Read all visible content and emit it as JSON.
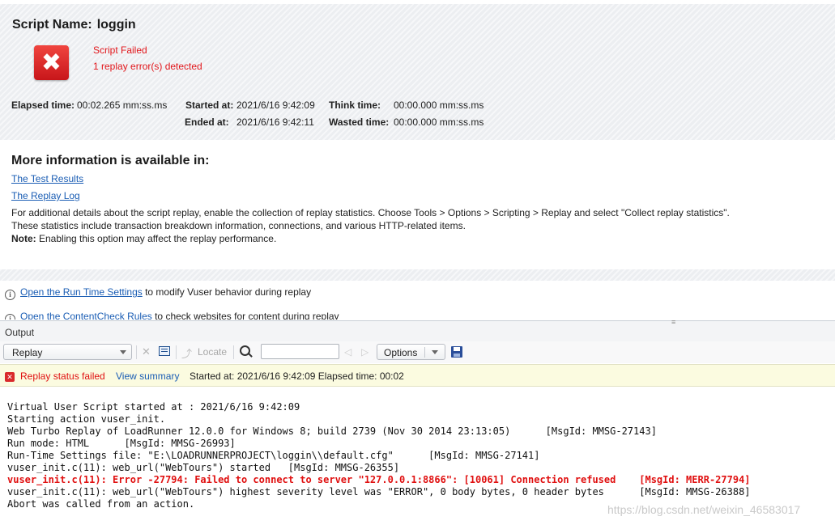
{
  "summary": {
    "script_label": "Script Name:",
    "script_name": "loggin",
    "status_title": "Script Failed",
    "status_detail": "1 replay error(s) detected",
    "elapsed_label": "Elapsed time:",
    "elapsed_value": "00:02.265 mm:ss.ms",
    "started_label": "Started at:",
    "started_value": "2021/6/16 9:42:09",
    "ended_label": "Ended at:",
    "ended_value": "2021/6/16 9:42:11",
    "think_label": "Think time:",
    "think_value": "00:00.000 mm:ss.ms",
    "wasted_label": "Wasted time:",
    "wasted_value": "00:00.000 mm:ss.ms"
  },
  "more": {
    "title": "More information is available in:",
    "link_results": "The Test Results",
    "link_log": "The Replay Log",
    "para1": "For additional details about the script replay, enable the collection of replay statistics. Choose Tools > Options > Scripting > Replay and select \"Collect replay statistics\".",
    "para2": "These statistics include transaction breakdown information, connections, and various HTTP-related items.",
    "note_label": "Note:",
    "note_text": " Enabling this option may affect the replay performance."
  },
  "tips": [
    {
      "link": "Open the Run Time Settings",
      "text": " to modify Vuser behavior during replay"
    },
    {
      "link": "Open the ContentCheck Rules",
      "text": " to check websites for content during replay"
    }
  ],
  "output": {
    "title": "Output",
    "mode_value": "Replay",
    "locate_label": "Locate",
    "search_value": "",
    "options_label": "Options"
  },
  "status": {
    "text": "Replay status failed",
    "view_summary": "View summary",
    "started": "Started at: 2021/6/16 9:42:09 Elapsed time: 00:02"
  },
  "log": [
    "Virtual User Script started at : 2021/6/16 9:42:09",
    "Starting action vuser_init.",
    "Web Turbo Replay of LoadRunner 12.0.0 for Windows 8; build 2739 (Nov 30 2014 23:13:05)      [MsgId: MMSG-27143]",
    "Run mode: HTML      [MsgId: MMSG-26993]",
    "Run-Time Settings file: \"E:\\LOADRUNNERPROJECT\\loggin\\\\default.cfg\"      [MsgId: MMSG-27141]",
    "vuser_init.c(11): web_url(\"WebTours\") started   [MsgId: MMSG-26355]",
    "vuser_init.c(11): Error -27794: Failed to connect to server \"127.0.0.1:8866\": [10061] Connection refused    [MsgId: MERR-27794]",
    "vuser_init.c(11): web_url(\"WebTours\") highest severity level was \"ERROR\", 0 body bytes, 0 header bytes      [MsgId: MMSG-26388]",
    "Abort was called from an action."
  ],
  "watermark": "https://blog.csdn.net/weixin_46583017",
  "colors": {
    "error": "#e01010",
    "link": "#1a5db4",
    "status_bg": "#fbfbe0"
  }
}
